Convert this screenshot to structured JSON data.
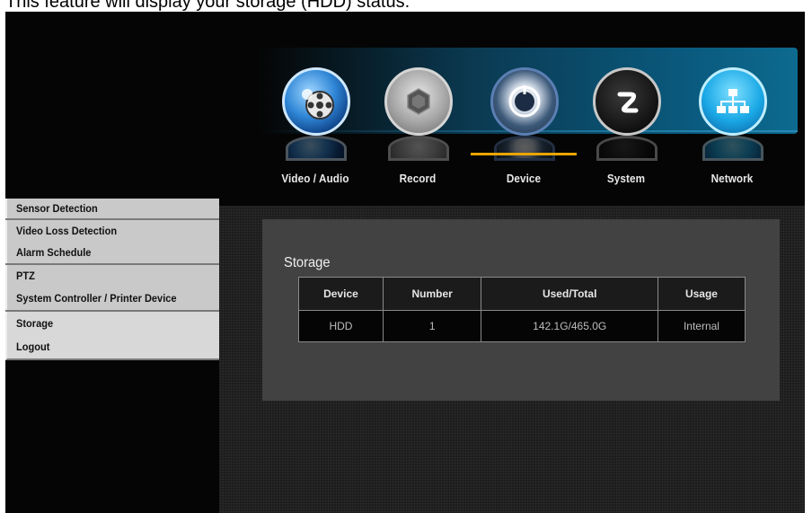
{
  "caption": "This feature will display your storage (HDD) status.",
  "nav": {
    "tabs": [
      {
        "label": "Video / Audio",
        "icon": "video-audio-icon"
      },
      {
        "label": "Record",
        "icon": "record-icon"
      },
      {
        "label": "Device",
        "icon": "device-icon",
        "active": true
      },
      {
        "label": "System",
        "icon": "system-icon"
      },
      {
        "label": "Network",
        "icon": "network-icon"
      }
    ]
  },
  "sidebar": {
    "items": [
      {
        "label": "Sensor Detection"
      },
      {
        "label": "Video Loss Detection"
      },
      {
        "label": "Alarm Schedule"
      },
      {
        "label": "PTZ"
      },
      {
        "label": "System Controller / Printer Device"
      },
      {
        "label": "Storage"
      },
      {
        "label": "Logout"
      }
    ]
  },
  "panel": {
    "title": "Storage",
    "table": {
      "headers": [
        "Device",
        "Number",
        "Used/Total",
        "Usage"
      ],
      "rows": [
        [
          "HDD",
          "1",
          "142.1G/465.0G",
          "Internal"
        ]
      ]
    }
  },
  "colors": {
    "accent_underline": "#e8a500",
    "sidebar_bg": "#c9c9c9",
    "panel_bg": "#424242"
  }
}
